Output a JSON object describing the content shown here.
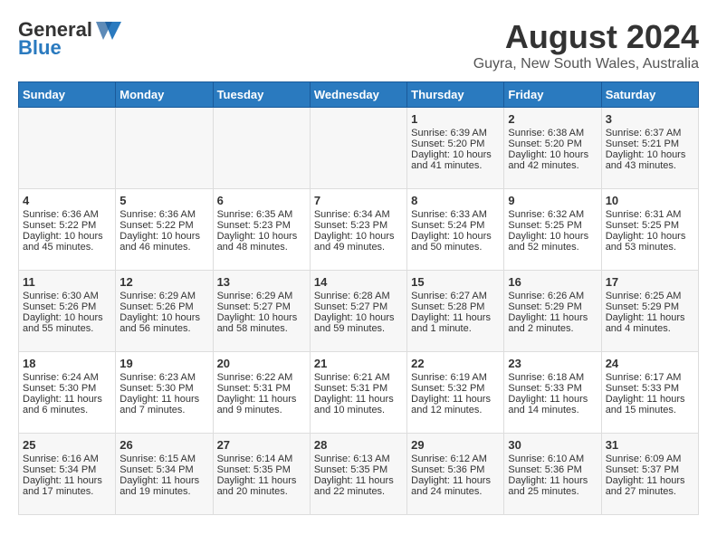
{
  "header": {
    "logo_general": "General",
    "logo_blue": "Blue",
    "month": "August 2024",
    "location": "Guyra, New South Wales, Australia"
  },
  "weekdays": [
    "Sunday",
    "Monday",
    "Tuesday",
    "Wednesday",
    "Thursday",
    "Friday",
    "Saturday"
  ],
  "weeks": [
    [
      {
        "day": "",
        "info": ""
      },
      {
        "day": "",
        "info": ""
      },
      {
        "day": "",
        "info": ""
      },
      {
        "day": "",
        "info": ""
      },
      {
        "day": "1",
        "info": "Sunrise: 6:39 AM\nSunset: 5:20 PM\nDaylight: 10 hours\nand 41 minutes."
      },
      {
        "day": "2",
        "info": "Sunrise: 6:38 AM\nSunset: 5:20 PM\nDaylight: 10 hours\nand 42 minutes."
      },
      {
        "day": "3",
        "info": "Sunrise: 6:37 AM\nSunset: 5:21 PM\nDaylight: 10 hours\nand 43 minutes."
      }
    ],
    [
      {
        "day": "4",
        "info": "Sunrise: 6:36 AM\nSunset: 5:22 PM\nDaylight: 10 hours\nand 45 minutes."
      },
      {
        "day": "5",
        "info": "Sunrise: 6:36 AM\nSunset: 5:22 PM\nDaylight: 10 hours\nand 46 minutes."
      },
      {
        "day": "6",
        "info": "Sunrise: 6:35 AM\nSunset: 5:23 PM\nDaylight: 10 hours\nand 48 minutes."
      },
      {
        "day": "7",
        "info": "Sunrise: 6:34 AM\nSunset: 5:23 PM\nDaylight: 10 hours\nand 49 minutes."
      },
      {
        "day": "8",
        "info": "Sunrise: 6:33 AM\nSunset: 5:24 PM\nDaylight: 10 hours\nand 50 minutes."
      },
      {
        "day": "9",
        "info": "Sunrise: 6:32 AM\nSunset: 5:25 PM\nDaylight: 10 hours\nand 52 minutes."
      },
      {
        "day": "10",
        "info": "Sunrise: 6:31 AM\nSunset: 5:25 PM\nDaylight: 10 hours\nand 53 minutes."
      }
    ],
    [
      {
        "day": "11",
        "info": "Sunrise: 6:30 AM\nSunset: 5:26 PM\nDaylight: 10 hours\nand 55 minutes."
      },
      {
        "day": "12",
        "info": "Sunrise: 6:29 AM\nSunset: 5:26 PM\nDaylight: 10 hours\nand 56 minutes."
      },
      {
        "day": "13",
        "info": "Sunrise: 6:29 AM\nSunset: 5:27 PM\nDaylight: 10 hours\nand 58 minutes."
      },
      {
        "day": "14",
        "info": "Sunrise: 6:28 AM\nSunset: 5:27 PM\nDaylight: 10 hours\nand 59 minutes."
      },
      {
        "day": "15",
        "info": "Sunrise: 6:27 AM\nSunset: 5:28 PM\nDaylight: 11 hours\nand 1 minute."
      },
      {
        "day": "16",
        "info": "Sunrise: 6:26 AM\nSunset: 5:29 PM\nDaylight: 11 hours\nand 2 minutes."
      },
      {
        "day": "17",
        "info": "Sunrise: 6:25 AM\nSunset: 5:29 PM\nDaylight: 11 hours\nand 4 minutes."
      }
    ],
    [
      {
        "day": "18",
        "info": "Sunrise: 6:24 AM\nSunset: 5:30 PM\nDaylight: 11 hours\nand 6 minutes."
      },
      {
        "day": "19",
        "info": "Sunrise: 6:23 AM\nSunset: 5:30 PM\nDaylight: 11 hours\nand 7 minutes."
      },
      {
        "day": "20",
        "info": "Sunrise: 6:22 AM\nSunset: 5:31 PM\nDaylight: 11 hours\nand 9 minutes."
      },
      {
        "day": "21",
        "info": "Sunrise: 6:21 AM\nSunset: 5:31 PM\nDaylight: 11 hours\nand 10 minutes."
      },
      {
        "day": "22",
        "info": "Sunrise: 6:19 AM\nSunset: 5:32 PM\nDaylight: 11 hours\nand 12 minutes."
      },
      {
        "day": "23",
        "info": "Sunrise: 6:18 AM\nSunset: 5:33 PM\nDaylight: 11 hours\nand 14 minutes."
      },
      {
        "day": "24",
        "info": "Sunrise: 6:17 AM\nSunset: 5:33 PM\nDaylight: 11 hours\nand 15 minutes."
      }
    ],
    [
      {
        "day": "25",
        "info": "Sunrise: 6:16 AM\nSunset: 5:34 PM\nDaylight: 11 hours\nand 17 minutes."
      },
      {
        "day": "26",
        "info": "Sunrise: 6:15 AM\nSunset: 5:34 PM\nDaylight: 11 hours\nand 19 minutes."
      },
      {
        "day": "27",
        "info": "Sunrise: 6:14 AM\nSunset: 5:35 PM\nDaylight: 11 hours\nand 20 minutes."
      },
      {
        "day": "28",
        "info": "Sunrise: 6:13 AM\nSunset: 5:35 PM\nDaylight: 11 hours\nand 22 minutes."
      },
      {
        "day": "29",
        "info": "Sunrise: 6:12 AM\nSunset: 5:36 PM\nDaylight: 11 hours\nand 24 minutes."
      },
      {
        "day": "30",
        "info": "Sunrise: 6:10 AM\nSunset: 5:36 PM\nDaylight: 11 hours\nand 25 minutes."
      },
      {
        "day": "31",
        "info": "Sunrise: 6:09 AM\nSunset: 5:37 PM\nDaylight: 11 hours\nand 27 minutes."
      }
    ]
  ]
}
